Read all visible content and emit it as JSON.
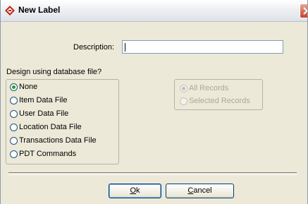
{
  "window": {
    "title": "New Label"
  },
  "form": {
    "description_label": "Description:",
    "description_value": "",
    "design_question": "Design using database file?"
  },
  "database_options": [
    {
      "label": "None",
      "checked": true
    },
    {
      "label": "Item Data File",
      "checked": false
    },
    {
      "label": "User Data File",
      "checked": false
    },
    {
      "label": "Location Data File",
      "checked": false
    },
    {
      "label": "Transactions Data File",
      "checked": false
    },
    {
      "label": "PDT Commands",
      "checked": false
    }
  ],
  "record_options": [
    {
      "label": "All Records",
      "checked": true,
      "disabled": true
    },
    {
      "label": "Selected Records",
      "checked": false,
      "disabled": true
    }
  ],
  "buttons": {
    "ok": {
      "mnemonic": "O",
      "rest": "k"
    },
    "cancel": {
      "mnemonic": "C",
      "rest": "ancel"
    }
  },
  "colors": {
    "radio_checked": "#21a121",
    "button_border": "#003c74"
  }
}
